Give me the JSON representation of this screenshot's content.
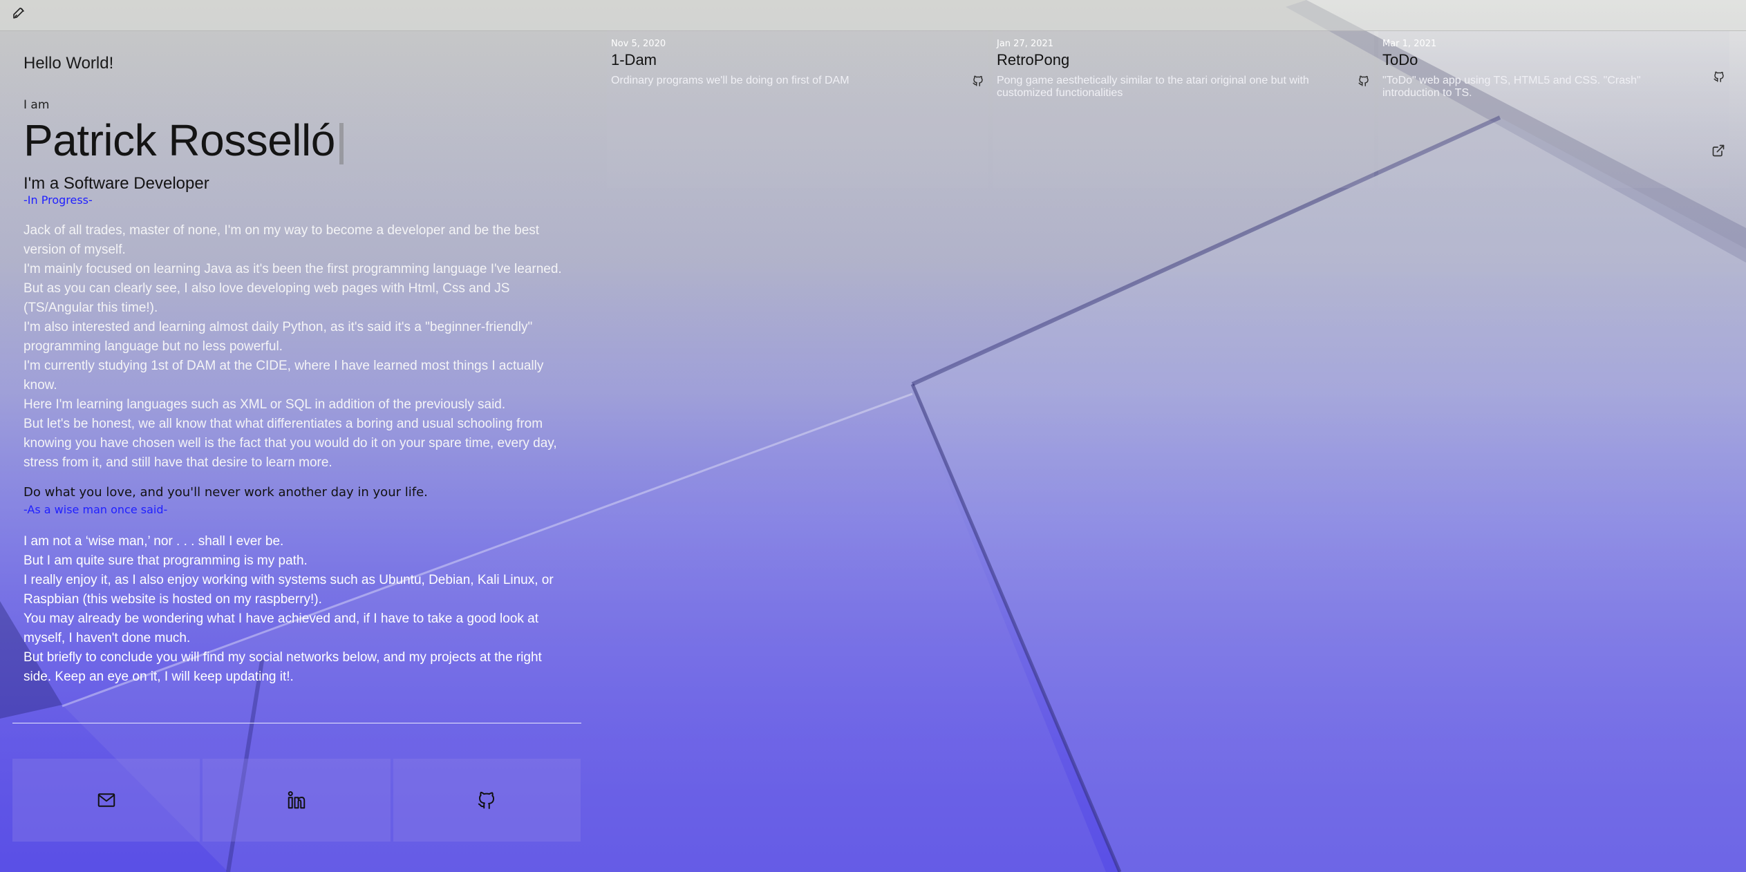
{
  "colors": {
    "accent_blue": "#2020ff",
    "bg_bottom": "#5a4ce6"
  },
  "topbar": {
    "logo_icon": "rocket-icon"
  },
  "intro": {
    "hello": "Hello World!",
    "iam": "I am",
    "name": "Patrick Rosselló",
    "role": "I'm a Software Developer",
    "progress": "-In Progress-",
    "paragraphs": [
      "Jack of all trades, master of none, I'm on my way to become a developer and be the best version of myself.",
      "I'm mainly focused on learning Java as it's been the first programming language I've learned.",
      "But as you can clearly see, I also love developing web pages with Html, Css and JS (TS/Angular this time!).",
      "I'm also interested and learning almost daily Python, as it's said it's a \"beginner-friendly\" programming language but no less powerful.",
      "I'm currently studying 1st of DAM at the CIDE, where I have learned most things I actually know.",
      "Here I'm learning languages such as XML or SQL in addition of the previously said.",
      "But let's be honest, we all know that what differentiates a boring and usual schooling from knowing you have chosen well is the fact that you would do it on your spare time, every day, stress from it, and still have that desire to learn more."
    ],
    "quote": "Do what you love, and you'll never work another day in your life.",
    "quote_source": "-As a wise man once said-",
    "paragraphs2": [
      "I am not a ‘wise man,’ nor . . . shall I ever be.",
      "But I am quite sure that programming is my path.",
      "I really enjoy it, as I also enjoy working with systems such as Ubuntu, Debian, Kali Linux, or Raspbian (this website is hosted on my raspberry!).",
      "You may already be wondering what I have achieved and, if I have to take a good look at myself, I haven't done much.",
      "But briefly to conclude you will find my social networks below, and my projects at the right side. Keep an eye on it, I will keep updating it!."
    ]
  },
  "socials": [
    {
      "icon": "mail-icon"
    },
    {
      "icon": "linkedin-icon"
    },
    {
      "icon": "github-icon"
    }
  ],
  "projects": [
    {
      "date": "Nov 5, 2020",
      "title": "1-Dam",
      "desc": "Ordinary programs we'll be doing on first of DAM",
      "icon": "github-icon"
    },
    {
      "date": "Jan 27, 2021",
      "title": "RetroPong",
      "desc": "Pong game aesthetically similar to the atari original one but with customized functionalities",
      "icon": "github-icon"
    },
    {
      "date": "Mar 1, 2021",
      "title": "ToDo",
      "desc": "\"ToDo\" web app using TS, HTML5 and CSS. \"Crash\" introduction to TS.",
      "icon": "github-icon",
      "ext_icon": "external-link-icon"
    }
  ]
}
